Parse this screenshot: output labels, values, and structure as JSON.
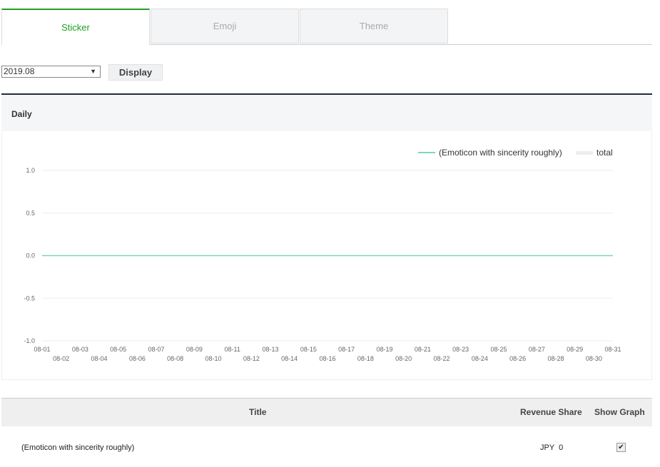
{
  "tabs": [
    {
      "label": "Sticker",
      "active": true
    },
    {
      "label": "Emoji",
      "active": false
    },
    {
      "label": "Theme",
      "active": false
    }
  ],
  "filter": {
    "month": "2019.08",
    "display_label": "Display"
  },
  "panel": {
    "title": "Daily"
  },
  "colors": {
    "accent": "#1fa01f",
    "series": "#7fd6b5",
    "total": "#eeeeee"
  },
  "chart_data": {
    "type": "line",
    "legend_position": "top-right",
    "grid": true,
    "ylim": [
      -1.0,
      1.0
    ],
    "yticks": [
      "1.0",
      "0.5",
      "0.0",
      "-0.5",
      "-1.0"
    ],
    "categories": [
      "08-01",
      "08-02",
      "08-03",
      "08-04",
      "08-05",
      "08-06",
      "08-07",
      "08-08",
      "08-09",
      "08-10",
      "08-11",
      "08-12",
      "08-13",
      "08-14",
      "08-15",
      "08-16",
      "08-17",
      "08-18",
      "08-19",
      "08-20",
      "08-21",
      "08-22",
      "08-23",
      "08-24",
      "08-25",
      "08-26",
      "08-27",
      "08-28",
      "08-29",
      "08-30",
      "08-31"
    ],
    "series": [
      {
        "name": "(Emoticon with sincerity roughly)",
        "values": [
          0,
          0,
          0,
          0,
          0,
          0,
          0,
          0,
          0,
          0,
          0,
          0,
          0,
          0,
          0,
          0,
          0,
          0,
          0,
          0,
          0,
          0,
          0,
          0,
          0,
          0,
          0,
          0,
          0,
          0,
          0
        ]
      },
      {
        "name": "total",
        "values": [
          0,
          0,
          0,
          0,
          0,
          0,
          0,
          0,
          0,
          0,
          0,
          0,
          0,
          0,
          0,
          0,
          0,
          0,
          0,
          0,
          0,
          0,
          0,
          0,
          0,
          0,
          0,
          0,
          0,
          0,
          0
        ]
      }
    ]
  },
  "table": {
    "headers": {
      "title": "Title",
      "revenue": "Revenue Share",
      "graph": "Show Graph"
    },
    "rows": [
      {
        "title": "(Emoticon with sincerity roughly)",
        "revenue": "JPY  0",
        "show_graph": true,
        "check": "✔"
      }
    ]
  }
}
